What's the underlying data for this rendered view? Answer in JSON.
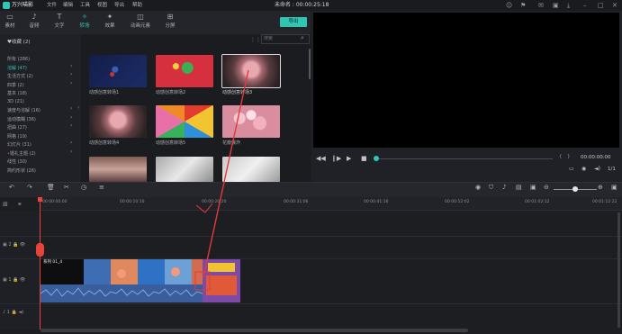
{
  "app": {
    "logo_text": "万兴喵影",
    "menu": [
      "文件",
      "编辑",
      "工具",
      "视图",
      "导出",
      "帮助"
    ],
    "document_title": "未命名 : 00:00:25:18",
    "window_icons": [
      "user-icon",
      "gift-icon",
      "bell-icon",
      "save-icon",
      "download-icon",
      "minimize-icon",
      "maximize-icon",
      "close-icon"
    ]
  },
  "media_tabs": [
    {
      "label": "素材",
      "icon": "folder-icon",
      "glyph": "▭"
    },
    {
      "label": "音频",
      "icon": "music-icon",
      "glyph": "♪"
    },
    {
      "label": "文字",
      "icon": "text-icon",
      "glyph": "T"
    },
    {
      "label": "转场",
      "icon": "transition-icon",
      "glyph": "✧",
      "active": true
    },
    {
      "label": "效果",
      "icon": "effects-icon",
      "glyph": "✦"
    },
    {
      "label": "动画元素",
      "icon": "elements-icon",
      "glyph": "◫"
    },
    {
      "label": "分屏",
      "icon": "split-screen-icon",
      "glyph": "⊞"
    }
  ],
  "export_label": "导出",
  "left_panel": {
    "favorites": "收藏 (2)",
    "categories": [
      {
        "label": "所有 (286)"
      },
      {
        "label": "溶解 (47)",
        "selected": true,
        "arrow": true
      },
      {
        "label": "生活方式 (2)",
        "arrow": true
      },
      {
        "label": "四季 (2)",
        "arrow": true
      },
      {
        "label": "基本 (18)"
      },
      {
        "label": "3D (21)"
      },
      {
        "label": "速度与溶解 (16)",
        "arrow": true
      },
      {
        "label": "运动模糊 (36)",
        "arrow": true
      },
      {
        "label": "扭曲 (27)",
        "arrow": true
      },
      {
        "label": "网格 (19)"
      },
      {
        "label": "幻灯片 (31)",
        "arrow": true
      },
      {
        "label": "婚礼主题 (2)",
        "arrow": true,
        "dot": true
      },
      {
        "label": "线性 (30)"
      },
      {
        "label": "简约形状 (26)"
      }
    ]
  },
  "search": {
    "placeholder": "搜索"
  },
  "transitions": [
    {
      "label": "动感创意转场1"
    },
    {
      "label": "动感创意转场2"
    },
    {
      "label": "动感创意转场3",
      "selected": true
    },
    {
      "label": "动感创意转场4"
    },
    {
      "label": "动感创意转场5"
    },
    {
      "label": "花瓣爆炸"
    },
    {
      "label": ""
    },
    {
      "label": ""
    }
  ],
  "preview": {
    "left_braces": "{",
    "right_braces": "}",
    "timecode": "00:00:00:00",
    "fit": "1/1"
  },
  "timeline": {
    "ruler": [
      "00:00:00:00",
      "00:00:10:10",
      "00:00:20:20",
      "00:00:31:06",
      "00:00:41:16",
      "00:00:52:02",
      "00:01:02:12",
      "00:01:12:22"
    ],
    "tracks": [
      {
        "label": "▣ 2",
        "icon": "video-track-icon"
      },
      {
        "label": "▣ 1",
        "icon": "video-track-icon"
      },
      {
        "label": "♪ 1",
        "icon": "audio-track-icon"
      }
    ],
    "clip_label": "系列 01_4"
  },
  "colors": {
    "accent": "#2fc6b4",
    "playhead": "#e8433a",
    "annotation": "#e23a3a"
  }
}
